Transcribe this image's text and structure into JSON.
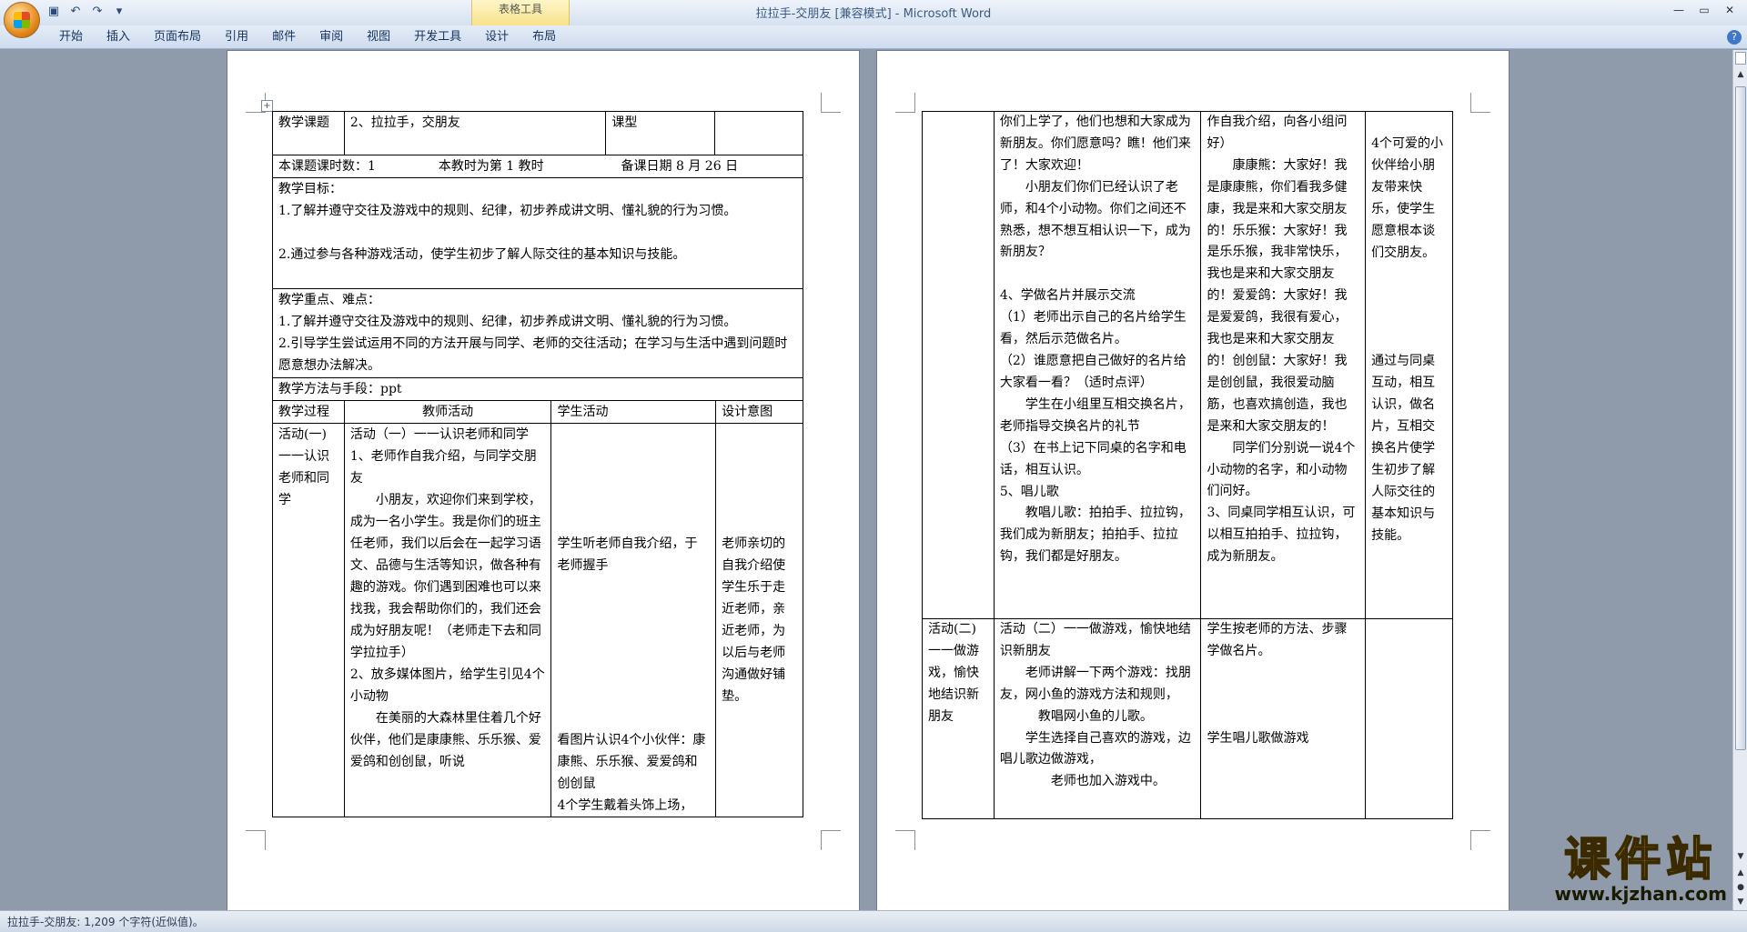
{
  "window": {
    "title": "拉拉手-交朋友 [兼容模式] - Microsoft Word",
    "context_tab": "表格工具"
  },
  "quick_access": [
    "save-icon",
    "undo-icon",
    "redo-icon",
    "customize-icon"
  ],
  "ribbon": {
    "tabs": [
      "开始",
      "插入",
      "页面布局",
      "引用",
      "邮件",
      "审阅",
      "视图",
      "开发工具",
      "设计",
      "布局"
    ]
  },
  "status": {
    "text": "拉拉手-交朋友: 1,209 个字符(近似值)。"
  },
  "watermark": {
    "brand": "课件站",
    "url": "www.kjzhan.com"
  },
  "page1": {
    "label_subject": "教学课题",
    "subject": "2、拉拉手，交朋友",
    "label_type": "课型",
    "hours": "本课题课时数：1",
    "current": "本教时为第 1 教时",
    "date": "备课日期 8 月 26 日",
    "goals_title": "教学目标：",
    "goal1": "1.了解并遵守交往及游戏中的规则、纪律，初步养成讲文明、懂礼貌的行为习惯。",
    "goal2": "2.通过参与各种游戏活动，使学生初步了解人际交往的基本知识与技能。",
    "key_title": "教学重点、难点：",
    "key1": "1.了解并遵守交往及游戏中的规则、纪律，初步养成讲文明、懂礼貌的行为习惯。",
    "key2": "2.引导学生尝试运用不同的方法开展与同学、老师的交往活动；在学习与生活中遇到问题时愿意想办法解决。",
    "method": "教学方法与手段：ppt",
    "h_process": "教学过程",
    "h_teacher": "教师活动",
    "h_student": "学生活动",
    "h_design": "设计意图",
    "activity_label": "活动(一)一一认识老师和同学",
    "teacher": [
      "活动（一）一一认识老师和同学",
      "1、老师作自我介绍，与同学交朋友",
      "　　小朋友，欢迎你们来到学校，成为一名小学生。我是你们的班主任老师，我们以后会在一起学习语文、品德与生活等知识，做各种有趣的游戏。你们遇到困难也可以来找我，我会帮助你们的，我们还会成为好朋友呢！（老师走下去和同学拉拉手）",
      "2、放多媒体图片，给学生引见4个小动物",
      "　　在美丽的大森林里住着几个好伙伴，他们是康康熊、乐乐猴、爱爱鸽和创创鼠，听说"
    ],
    "student1": "学生听老师自我介绍，于老师握手",
    "student2": "看图片认识4个小伙伴：康康熊、乐乐猴、爱爱鸽和创创鼠",
    "student3": "4个学生戴着头饰上场，",
    "design1": "老师亲切的自我介绍使学生乐于走近老师，亲近老师，为以后与老师沟通做好铺垫。"
  },
  "page2": {
    "teacher": [
      "你们上学了，他们也想和大家成为新朋友。你们愿意吗？瞧！他们来了！大家欢迎！",
      "　　小朋友们你们已经认识了老师，和4个小动物。你们之间还不熟悉，想不想互相认识一下，成为新朋友？",
      "4、学做名片并展示交流",
      "（1）老师出示自己的名片给学生看，然后示范做名片。",
      "（2）谁愿意把自己做好的名片给大家看一看？（适时点评）",
      "　　学生在小组里互相交换名片，老师指导交换名片的礼节",
      "（3）在书上记下同桌的名字和电话，相互认识。",
      "5、唱儿歌",
      "　　教唱儿歌：拍拍手、拉拉钩，我们成为新朋友；拍拍手、拉拉钩，我们都是好朋友。"
    ],
    "student": [
      "作自我介绍，向各小组问好）",
      "　　康康熊：大家好！我是康康熊，你们看我多健康，我是来和大家交朋友的！乐乐猴：大家好！我是乐乐猴，我非常快乐，我也是来和大家交朋友的！爱爱鸽：大家好！我是爱爱鸽，我很有爱心，我也是来和大家交朋友的！创创鼠：大家好！我是创创鼠，我很爱动脑筋，也喜欢搞创造，我也是来和大家交朋友的！",
      "　　同学们分别说一说4个小动物的名字，和小动物们问好。",
      "3、同桌同学相互认识，可以相互拍拍手、拉拉钩，成为新朋友。"
    ],
    "design": [
      "4个可爱的小伙伴给小朋友带来快乐，使学生愿意根本谈们交朋友。",
      "通过与同桌互动，相互认识，做名片，互相交换名片使学生初步了解人际交往的基本知识与技能。"
    ],
    "activity2_label": "活动(二)一一做游戏，愉快地结识新朋友",
    "teacher2": [
      "活动（二）一一做游戏，愉快地结识新朋友",
      "　　老师讲解一下两个游戏：找朋友，网小鱼的游戏方法和规则，",
      "　　　教唱网小鱼的儿歌。",
      "　　学生选择自己喜欢的游戏，边唱儿歌边做游戏，",
      "　　　　老师也加入游戏中。"
    ],
    "student2": [
      "学生按老师的方法、步骤学做名片。",
      "学生唱儿歌做游戏"
    ]
  }
}
